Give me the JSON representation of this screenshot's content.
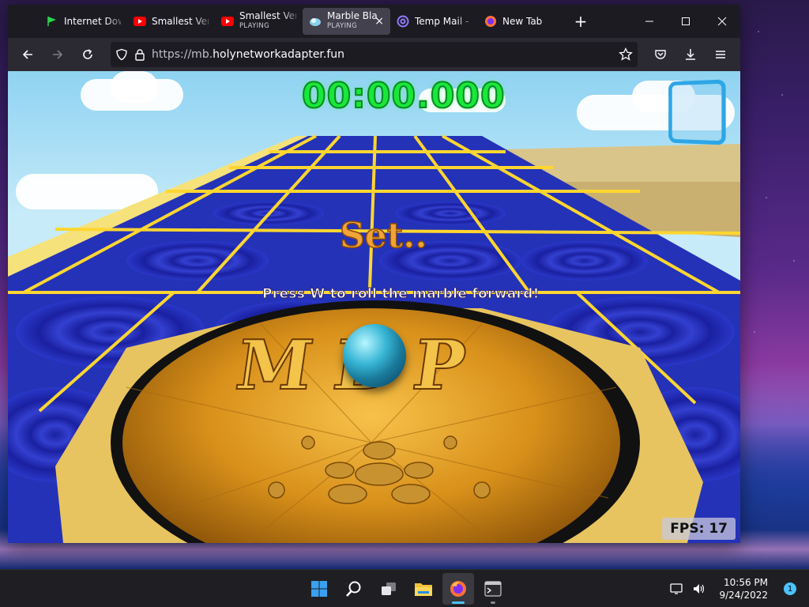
{
  "colors": {
    "accent": "#4cc2ff",
    "timer_green": "#18e83a",
    "set_orange": "#f0a438",
    "tile_blue": "#2432b8",
    "tile_line_yellow": "#ffd630"
  },
  "browser": {
    "tabs": [
      {
        "title": "Internet Dow",
        "subtitle": "",
        "icon": "green-flag-icon",
        "active": false
      },
      {
        "title": "Smallest Vers",
        "subtitle": "",
        "icon": "youtube-icon",
        "active": false
      },
      {
        "title": "Smallest Vers",
        "subtitle": "PLAYING",
        "icon": "youtube-icon",
        "active": false
      },
      {
        "title": "Marble Bla",
        "subtitle": "PLAYING",
        "icon": "marble-blast-icon",
        "active": true
      },
      {
        "title": "Temp Mail - ",
        "subtitle": "",
        "icon": "at-sign-icon",
        "active": false
      },
      {
        "title": "New Tab",
        "subtitle": "",
        "icon": "firefox-icon",
        "active": false
      }
    ],
    "url_prefix": "https://mb.",
    "url_domain": "holynetworkadapter.fun",
    "close_tab_glyph": "×",
    "new_tab_glyph": "+"
  },
  "game": {
    "timer": "00:00.000",
    "status": "Set..",
    "hint": "Press W to roll the marble forward!",
    "fps_label": "FPS: 17",
    "logo_text": "MBP"
  },
  "taskbar": {
    "apps": [
      {
        "name": "start-button",
        "icon": "windows-icon",
        "active": false
      },
      {
        "name": "search-button",
        "icon": "search-icon",
        "active": false
      },
      {
        "name": "task-view-button",
        "icon": "task-view-icon",
        "active": false
      },
      {
        "name": "file-explorer-button",
        "icon": "folder-icon",
        "active": false
      },
      {
        "name": "firefox-button",
        "icon": "firefox-icon",
        "active": true
      },
      {
        "name": "terminal-button",
        "icon": "terminal-icon",
        "active": false
      }
    ],
    "time": "10:56 PM",
    "date": "9/24/2022",
    "notification_count": "1"
  }
}
